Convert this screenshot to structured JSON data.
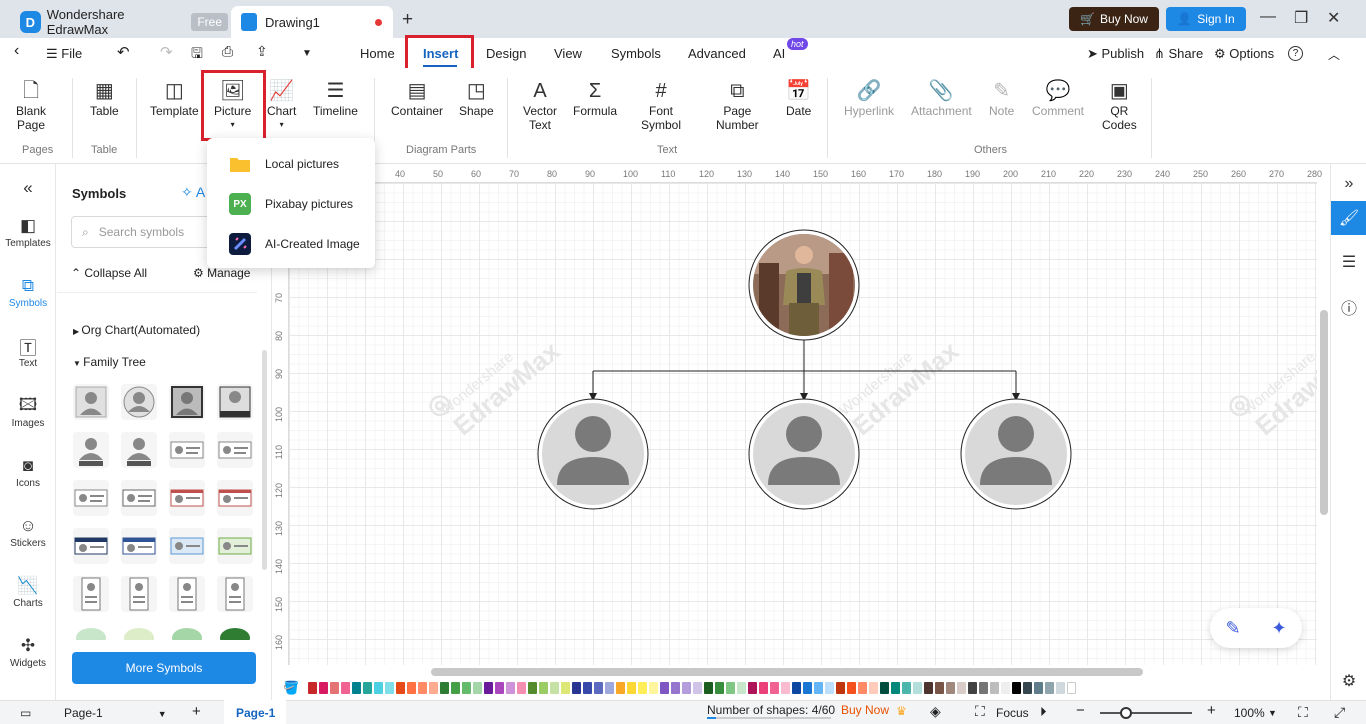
{
  "titlebar": {
    "app_name": "Wondershare EdrawMax",
    "free_badge": "Free",
    "doc_tab": "Drawing1",
    "new_tab": "+",
    "buy_now": "Buy Now",
    "sign_in": "Sign In"
  },
  "menubar": {
    "back": "‹",
    "file": "File",
    "tabs": [
      "Home",
      "Insert",
      "Design",
      "View",
      "Symbols",
      "Advanced",
      "AI"
    ],
    "ai_badge": "hot",
    "publish": "Publish",
    "share": "Share",
    "options": "Options",
    "help": "?"
  },
  "ribbon": {
    "buttons": {
      "blank_page": [
        "Blank",
        "Page"
      ],
      "table": "Table",
      "template": "Template",
      "picture": "Picture",
      "chart": "Chart",
      "timeline": "Timeline",
      "container": "Container",
      "shape": "Shape",
      "vector_text": [
        "Vector",
        "Text"
      ],
      "formula": "Formula",
      "font_symbol": [
        "Font",
        "Symbol"
      ],
      "page_number": [
        "Page",
        "Number"
      ],
      "date": "Date",
      "hyperlink": "Hyperlink",
      "attachment": "Attachment",
      "note": "Note",
      "comment": "Comment",
      "qr_codes": [
        "QR",
        "Codes"
      ]
    },
    "groups": [
      "Pages",
      "Table",
      "Diagram Parts",
      "Text",
      "Others"
    ]
  },
  "picture_dropdown": {
    "items": [
      {
        "label": "Local pictures",
        "icon": "folder-icon"
      },
      {
        "label": "Pixabay pictures",
        "icon": "pixabay-icon",
        "icon_text": "PX"
      },
      {
        "label": "AI-Created Image",
        "icon": "ai-image-icon"
      }
    ]
  },
  "leftbar": {
    "items": [
      "Templates",
      "Symbols",
      "Text",
      "Images",
      "Icons",
      "Stickers",
      "Charts",
      "Widgets"
    ],
    "active": "Symbols"
  },
  "symbols_panel": {
    "title": "Symbols",
    "ai_label": "A",
    "search_placeholder": "Search symbols",
    "collapse_all": "Collapse All",
    "manage": "Manage",
    "categories": [
      "Org Chart(Automated)",
      "Family Tree"
    ],
    "more_symbols": "More Symbols"
  },
  "rulers": {
    "top": [
      "40",
      "50",
      "60",
      "70",
      "80",
      "90",
      "100",
      "110",
      "120",
      "130",
      "140",
      "150",
      "160",
      "170",
      "180",
      "190",
      "200",
      "210",
      "220",
      "230",
      "240",
      "250",
      "260",
      "270",
      "280"
    ],
    "left": [
      "70",
      "80",
      "90",
      "100",
      "110",
      "120",
      "130",
      "140",
      "150",
      "160"
    ]
  },
  "canvas": {
    "watermark_small": "Wondershare",
    "watermark_big": "EdrawMax",
    "org_nodes": [
      {
        "role": "root",
        "image": "photo"
      },
      {
        "role": "child",
        "image": "placeholder"
      },
      {
        "role": "child",
        "image": "placeholder"
      },
      {
        "role": "child",
        "image": "placeholder"
      }
    ]
  },
  "colors": {
    "accent": "#1e88e5",
    "highlight_box": "#d9212d",
    "buy_now_bg": "#3b2414",
    "palette": [
      "#c62828",
      "#d81b60",
      "#e57373",
      "#f06292",
      "#00838f",
      "#26a69a",
      "#4dd0e1",
      "#80deea",
      "#e64a19",
      "#ff7043",
      "#ff8a65",
      "#ffab91",
      "#2e7d32",
      "#43a047",
      "#66bb6a",
      "#a5d6a7",
      "#6a1b9a",
      "#ab47bc",
      "#ce93d8",
      "#f48fb1",
      "#558b2f",
      "#9ccc65",
      "#c5e1a5",
      "#dce775",
      "#283593",
      "#3949ab",
      "#5c6bc0",
      "#9fa8da",
      "#f9a825",
      "#fdd835",
      "#ffee58",
      "#fff59d",
      "#7e57c2",
      "#9575cd",
      "#b39ddb",
      "#d1c4e9",
      "#1b5e20",
      "#388e3c",
      "#81c784",
      "#c8e6c9",
      "#ad1457",
      "#ec407a",
      "#f06292",
      "#f8bbd0",
      "#0d47a1",
      "#1976d2",
      "#64b5f6",
      "#bbdefb",
      "#bf360c",
      "#f4511e",
      "#ff8a65",
      "#ffccbc",
      "#004d40",
      "#00897b",
      "#4db6ac",
      "#b2dfdb",
      "#4e342e",
      "#795548",
      "#a1887f",
      "#d7ccc8",
      "#424242",
      "#757575",
      "#bdbdbd",
      "#eeeeee",
      "#000000",
      "#37474f",
      "#607d8b",
      "#90a4ae",
      "#cfd8dc",
      "#ffffff"
    ]
  },
  "statusbar": {
    "page_select": "Page-1",
    "add_page": "+",
    "active_page": "Page-1",
    "shapes_count": "Number of shapes: 4/60",
    "buy_now": "Buy Now",
    "focus": "Focus",
    "zoom": "100%"
  }
}
